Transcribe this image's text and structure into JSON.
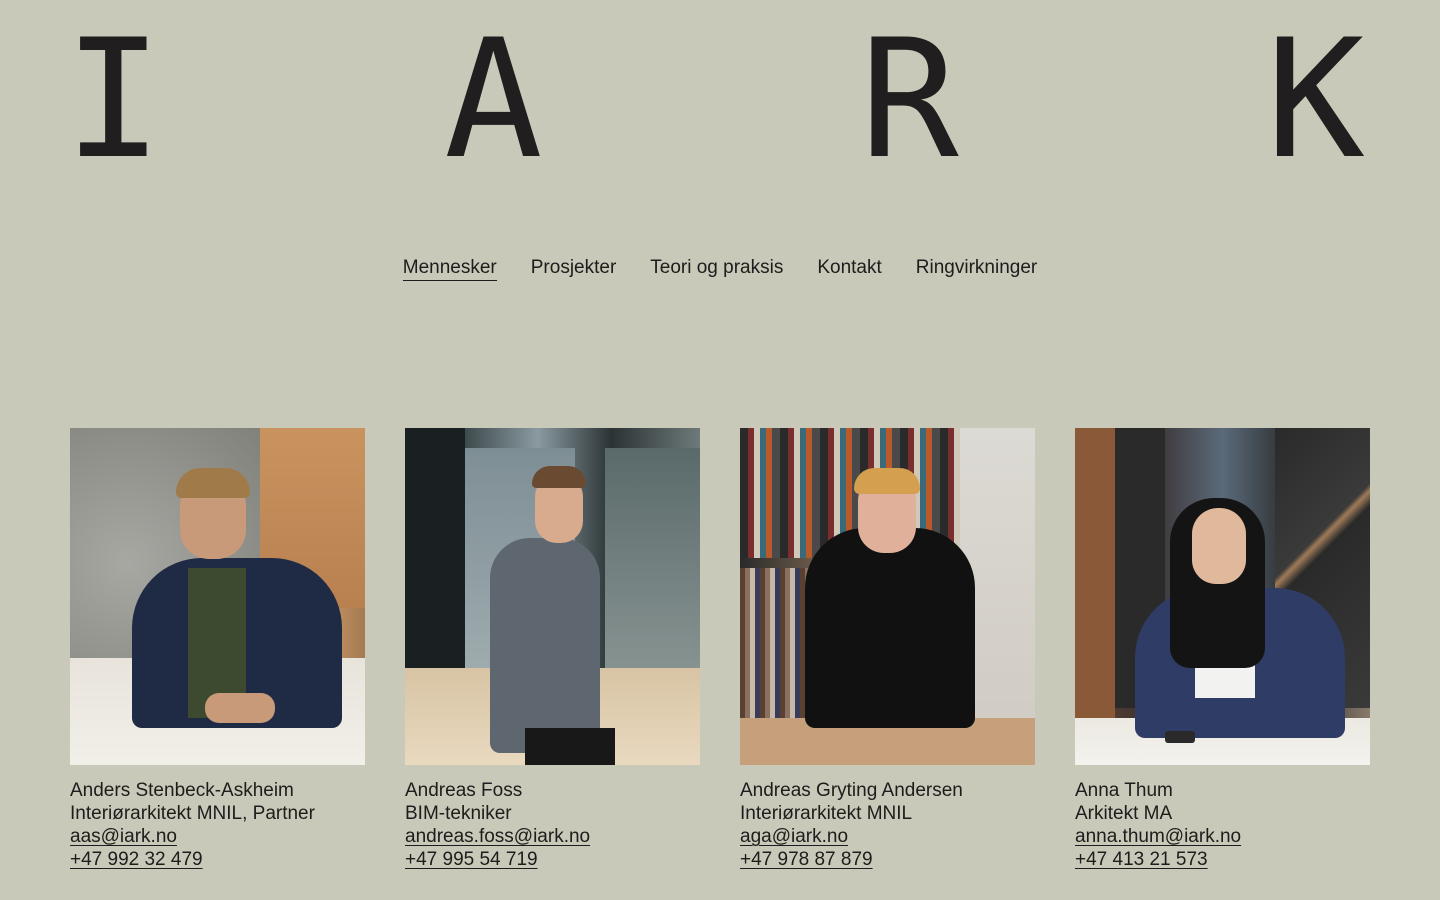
{
  "logo": {
    "letters": [
      "I",
      "A",
      "R",
      "K"
    ]
  },
  "nav": {
    "items": [
      {
        "label": "Mennesker",
        "active": true
      },
      {
        "label": "Prosjekter",
        "active": false
      },
      {
        "label": "Teori og praksis",
        "active": false
      },
      {
        "label": "Kontakt",
        "active": false
      },
      {
        "label": "Ringvirkninger",
        "active": false
      }
    ]
  },
  "people": [
    {
      "name": "Anders Stenbeck-Askheim",
      "title": "Interiørarkitekt MNIL, Partner",
      "email": "aas@iark.no",
      "phone": "+47 992 32 479"
    },
    {
      "name": "Andreas Foss",
      "title": "BIM-tekniker",
      "email": "andreas.foss@iark.no",
      "phone": "+47 995 54 719"
    },
    {
      "name": "Andreas Gryting Andersen",
      "title": "Interiørarkitekt MNIL",
      "email": "aga@iark.no",
      "phone": "+47 978 87 879"
    },
    {
      "name": "Anna Thum",
      "title": "Arkitekt MA",
      "email": "anna.thum@iark.no",
      "phone": "+47 413 21 573"
    }
  ],
  "colors": {
    "background": "#c9c9b9",
    "text": "#1e1c1c"
  }
}
